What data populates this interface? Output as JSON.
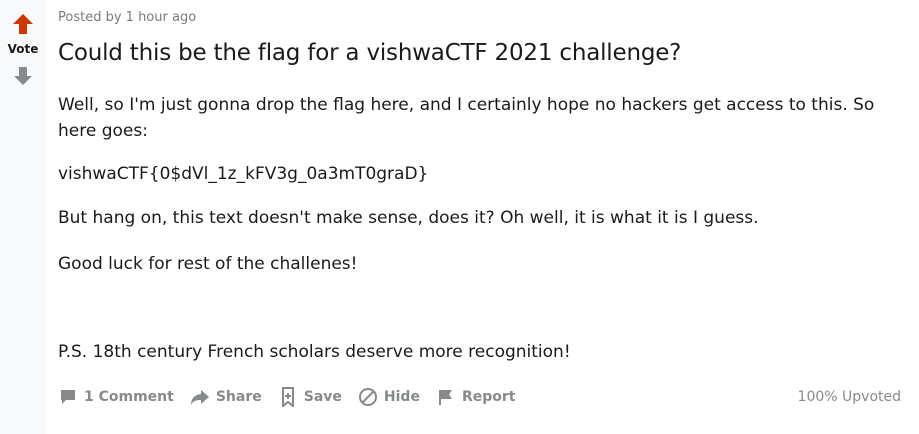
{
  "vote": {
    "label": "Vote"
  },
  "post": {
    "meta": "Posted by 1 hour ago",
    "title": "Could this be the flag for a vishwaCTF 2021 challenge?",
    "paragraphs": [
      "Well, so I'm just gonna drop the flag here, and I certainly hope no hackers get access to this. So here goes:",
      "vishwaCTF{0$dVl_1z_kFV3g_0a3mT0graD}",
      "But hang on, this text doesn't make sense, does it? Oh well, it is what it is I guess.",
      "Good luck for rest of the challenes!",
      "P.S. 18th century French scholars deserve more recognition!"
    ]
  },
  "actions": {
    "comments": "1 Comment",
    "share": "Share",
    "save": "Save",
    "hide": "Hide",
    "report": "Report",
    "upvoted": "100% Upvoted"
  },
  "icons": {
    "upvote": "arrow-up-icon",
    "downvote": "arrow-down-icon",
    "comment": "comment-icon",
    "share": "share-arrow-icon",
    "save": "bookmark-icon",
    "hide": "hide-icon",
    "report": "flag-icon"
  },
  "colors": {
    "upvote_active": "#cc3700",
    "icon_gray": "#878a8c",
    "meta_gray": "#787c7e",
    "text": "#1a1a1b",
    "vote_bg": "#f8f9fa"
  }
}
